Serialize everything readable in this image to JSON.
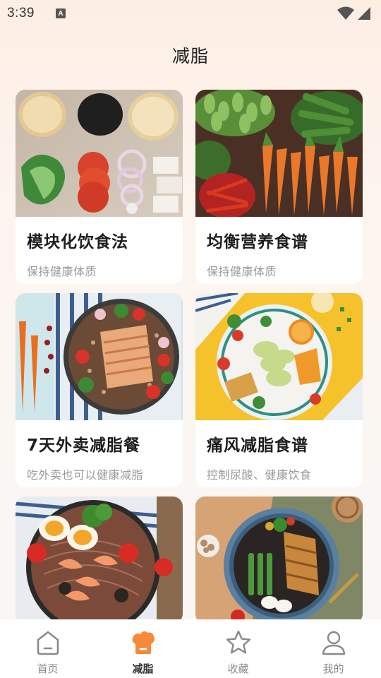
{
  "status": {
    "time": "3:39",
    "notification_icon": "text-a-icon",
    "wifi_icon": "wifi-icon",
    "signal_icon": "signal-icon"
  },
  "page": {
    "title": "减脂"
  },
  "cards": [
    {
      "title": "模块化饮食法",
      "subtitle": "保持健康体质",
      "image": "food-ingredients"
    },
    {
      "title": "均衡营养食谱",
      "subtitle": "保持健康体质",
      "image": "vegetables"
    },
    {
      "title": "7天外卖减脂餐",
      "subtitle": "吃外卖也可以健康减脂",
      "image": "chicken-bowl"
    },
    {
      "title": "痛风减脂食谱",
      "subtitle": "控制尿酸、健康饮食",
      "image": "salad-plate"
    },
    {
      "title": "",
      "subtitle": "",
      "image": "noodle-bowl"
    },
    {
      "title": "",
      "subtitle": "",
      "image": "grain-bowl"
    }
  ],
  "tabbar": {
    "items": [
      {
        "label": "首页",
        "icon": "home-icon",
        "active": false
      },
      {
        "label": "减脂",
        "icon": "chef-hat-icon",
        "active": true
      },
      {
        "label": "收藏",
        "icon": "star-icon",
        "active": false
      },
      {
        "label": "我的",
        "icon": "person-icon",
        "active": false
      }
    ]
  },
  "colors": {
    "accent": "#f58a3a",
    "background": "#fdf1e8",
    "tab_inactive": "#8a8a8a"
  }
}
